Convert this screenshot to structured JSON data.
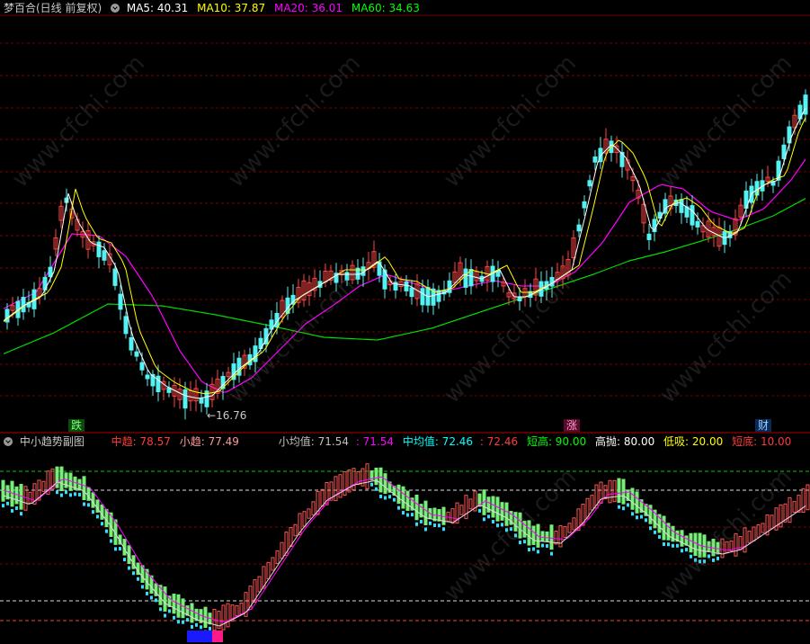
{
  "main": {
    "title": "梦百合(日线 前复权)",
    "ma": [
      {
        "label": "MA5: 40.31",
        "color": "#ffffff"
      },
      {
        "label": "MA10: 37.87",
        "color": "#ffff00"
      },
      {
        "label": "MA20: 36.01",
        "color": "#ff00ff"
      },
      {
        "label": "MA60: 34.63",
        "color": "#00ff00"
      }
    ],
    "low_marker": "16.76",
    "signals": {
      "fall": "跌",
      "rise": "涨",
      "wealth": "财"
    }
  },
  "sub": {
    "title": "中小趋势副图",
    "items": [
      {
        "label": "中趋: 78.57",
        "color": "#ff3b3b"
      },
      {
        "label": "小趋: 77.49",
        "color": "#ff9a9a"
      },
      {
        "label": "小均值: 71.54",
        "color": "#c0c0c0"
      },
      {
        "label": ": 71.54",
        "color": "#ff00ff"
      },
      {
        "label": "中均值: 72.46",
        "color": "#00ffff"
      },
      {
        "label": ": 72.46",
        "color": "#ff3b3b"
      },
      {
        "label": "短高: 90.00",
        "color": "#00ff00"
      },
      {
        "label": "高抛: 80.00",
        "color": "#ffffff"
      },
      {
        "label": "低吸: 20.00",
        "color": "#ffff00"
      },
      {
        "label": "短底: 10.00",
        "color": "#ff3b3b"
      }
    ]
  },
  "watermark": "www.cfchi.com",
  "colors": {
    "up": "#ff4444",
    "down": "#00ffff",
    "grid": "#8b0000",
    "bg": "#000000"
  }
}
